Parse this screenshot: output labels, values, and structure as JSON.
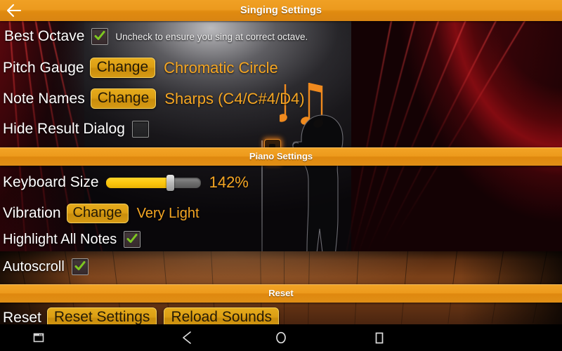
{
  "titlebar": {
    "title": "Singing Settings",
    "back_icon": "arrow-left-icon"
  },
  "sections": {
    "singing": {
      "rows": {
        "best_octave": {
          "label": "Best Octave",
          "checked_icon": "checkmark-icon",
          "hint": "Uncheck to ensure you sing at correct octave."
        },
        "pitch_gauge": {
          "label": "Pitch Gauge",
          "button": "Change",
          "value": "Chromatic Circle"
        },
        "note_names": {
          "label": "Note Names",
          "button": "Change",
          "value": "Sharps (C4/C#4/D4)"
        },
        "hide_result_dialog": {
          "label": "Hide Result Dialog"
        }
      }
    },
    "piano": {
      "header": "Piano Settings",
      "rows": {
        "keyboard_size": {
          "label": "Keyboard Size",
          "value": "142%",
          "slider_percent": 70
        },
        "vibration": {
          "label": "Vibration",
          "button": "Change",
          "value": "Very Light"
        },
        "highlight_all_notes": {
          "label": "Highlight All Notes",
          "checked_icon": "checkmark-icon"
        },
        "autoscroll": {
          "label": "Autoscroll",
          "checked_icon": "checkmark-icon"
        }
      }
    },
    "reset": {
      "header": "Reset",
      "rows": {
        "reset": {
          "label": "Reset",
          "button_reset_settings": "Reset Settings",
          "button_reload_sounds": "Reload Sounds"
        }
      }
    }
  },
  "navbar": {
    "keyboard_icon": "keyboard-toggle-icon",
    "back_icon": "nav-back-triangle-icon",
    "home_icon": "nav-home-circle-icon",
    "recents_icon": "nav-recents-square-icon"
  },
  "colors": {
    "accent_orange": "#f2a426",
    "value_orange": "#f5a623",
    "button_gold": "#dc9f14",
    "check_green": "#7ec820"
  }
}
